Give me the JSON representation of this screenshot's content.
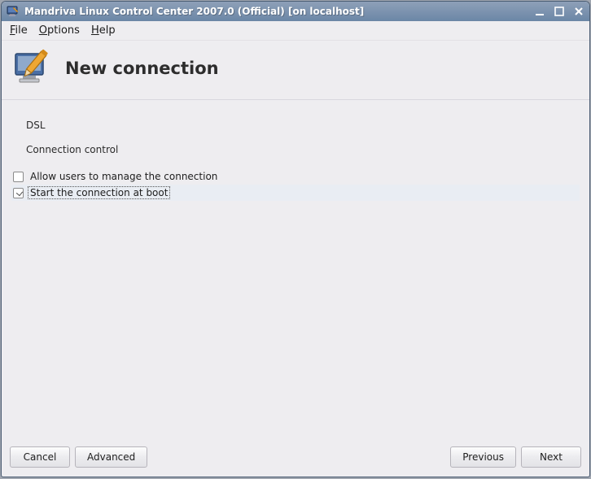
{
  "window": {
    "title": "Mandriva Linux Control Center 2007.0 (Official) [on localhost]"
  },
  "menubar": {
    "file": "File",
    "options": "Options",
    "help": "Help"
  },
  "header": {
    "title": "New connection"
  },
  "content": {
    "section_label": "DSL",
    "subsection_label": "Connection control",
    "checkboxes": [
      {
        "label": "Allow users to manage the connection",
        "checked": false,
        "selected": false
      },
      {
        "label": "Start the connection at boot",
        "checked": true,
        "selected": true
      }
    ]
  },
  "buttons": {
    "cancel": "Cancel",
    "advanced": "Advanced",
    "previous": "Previous",
    "next": "Next"
  },
  "icons": {
    "app": "screen-wrench-icon",
    "minimize": "minimize-icon",
    "maximize": "maximize-icon",
    "close": "close-icon"
  }
}
